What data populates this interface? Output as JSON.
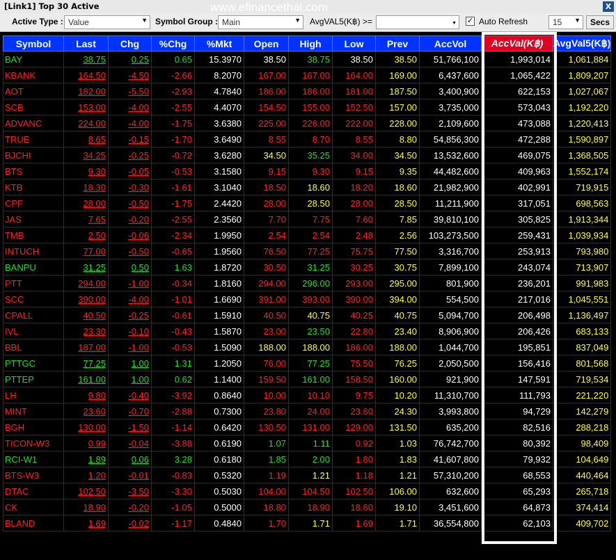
{
  "window": {
    "title": "[Link1] Top 30 Active",
    "close_label": "X",
    "watermark": "www.efinancethai.com"
  },
  "toolbar": {
    "active_type_label": "Active Type :",
    "active_type_value": "Value",
    "symbol_group_label": "Symbol Group :",
    "symbol_group_value": "Main",
    "filter_label": "AvgVAL5(K฿) >=",
    "filter_value": "",
    "auto_refresh_label": "Auto Refresh",
    "auto_refresh_checked": "✓",
    "interval_value": "15",
    "secs_label": "Secs"
  },
  "table": {
    "columns": [
      "Symbol",
      "Last",
      "Chg",
      "%Chg",
      "%Mkt",
      "Open",
      "High",
      "Low",
      "Prev",
      "AccVol",
      "AccVal(K฿)",
      "AvgVal5(K฿)"
    ],
    "rows": [
      {
        "sym": "BAY",
        "sc": "grn",
        "last": "38.75",
        "lc": "grn",
        "chg": "0.25",
        "cc": "grn",
        "pchg": "0.65",
        "pc": "grn",
        "mkt": "15.3970",
        "open": "38.50",
        "oc": "wht",
        "high": "38.75",
        "hc": "grn",
        "low": "38.50",
        "loc": "wht",
        "prev": "38.50",
        "accvol": "51,766,100",
        "accval": "1,993,014",
        "avgval": "1,061,884"
      },
      {
        "sym": "KBANK",
        "sc": "red",
        "last": "164.50",
        "lc": "red",
        "chg": "-4.50",
        "cc": "red",
        "pchg": "-2.66",
        "pc": "red",
        "mkt": "8.2070",
        "open": "167.00",
        "oc": "red",
        "high": "167.00",
        "hc": "red",
        "low": "164.00",
        "loc": "red",
        "prev": "169.00",
        "accvol": "6,437,600",
        "accval": "1,065,422",
        "avgval": "1,809,207"
      },
      {
        "sym": "AOT",
        "sc": "red",
        "last": "182.00",
        "lc": "red",
        "chg": "-5.50",
        "cc": "red",
        "pchg": "-2.93",
        "pc": "red",
        "mkt": "4.7840",
        "open": "186.00",
        "oc": "red",
        "high": "186.00",
        "hc": "red",
        "low": "181.00",
        "loc": "red",
        "prev": "187.50",
        "accvol": "3,400,900",
        "accval": "622,153",
        "avgval": "1,027,067"
      },
      {
        "sym": "SCB",
        "sc": "red",
        "last": "153.00",
        "lc": "red",
        "chg": "-4.00",
        "cc": "red",
        "pchg": "-2.55",
        "pc": "red",
        "mkt": "4.4070",
        "open": "154.50",
        "oc": "red",
        "high": "155.00",
        "hc": "red",
        "low": "152.50",
        "loc": "red",
        "prev": "157.00",
        "accvol": "3,735,000",
        "accval": "573,043",
        "avgval": "1,192,220"
      },
      {
        "sym": "ADVANC",
        "sc": "red",
        "last": "224.00",
        "lc": "red",
        "chg": "-4.00",
        "cc": "red",
        "pchg": "-1.75",
        "pc": "red",
        "mkt": "3.6380",
        "open": "225.00",
        "oc": "red",
        "high": "226.00",
        "hc": "red",
        "low": "222.00",
        "loc": "red",
        "prev": "228.00",
        "accvol": "2,109,600",
        "accval": "473,088",
        "avgval": "1,220,413"
      },
      {
        "sym": "TRUE",
        "sc": "red",
        "last": "8.65",
        "lc": "red",
        "chg": "-0.15",
        "cc": "red",
        "pchg": "-1.70",
        "pc": "red",
        "mkt": "3.6490",
        "open": "8.55",
        "oc": "red",
        "high": "8.70",
        "hc": "red",
        "low": "8.55",
        "loc": "red",
        "prev": "8.80",
        "accvol": "54,856,300",
        "accval": "472,288",
        "avgval": "1,590,897"
      },
      {
        "sym": "BJCHI",
        "sc": "red",
        "last": "34.25",
        "lc": "red",
        "chg": "-0.25",
        "cc": "red",
        "pchg": "-0.72",
        "pc": "red",
        "mkt": "3.6280",
        "open": "34.50",
        "oc": "yel",
        "high": "35.25",
        "hc": "grn",
        "low": "34.00",
        "loc": "red",
        "prev": "34.50",
        "accvol": "13,532,600",
        "accval": "469,075",
        "avgval": "1,368,505"
      },
      {
        "sym": "BTS",
        "sc": "red",
        "last": "9.30",
        "lc": "red",
        "chg": "-0.05",
        "cc": "red",
        "pchg": "-0.53",
        "pc": "red",
        "mkt": "3.1580",
        "open": "9.15",
        "oc": "red",
        "high": "9.30",
        "hc": "red",
        "low": "9.15",
        "loc": "red",
        "prev": "9.35",
        "accvol": "44,482,600",
        "accval": "409,963",
        "avgval": "1,552,174"
      },
      {
        "sym": "KTB",
        "sc": "red",
        "last": "18.30",
        "lc": "red",
        "chg": "-0.30",
        "cc": "red",
        "pchg": "-1.61",
        "pc": "red",
        "mkt": "3.1040",
        "open": "18.50",
        "oc": "red",
        "high": "18.60",
        "hc": "yel",
        "low": "18.20",
        "loc": "red",
        "prev": "18.60",
        "accvol": "21,982,900",
        "accval": "402,991",
        "avgval": "719,915"
      },
      {
        "sym": "CPF",
        "sc": "red",
        "last": "28.00",
        "lc": "red",
        "chg": "-0.50",
        "cc": "red",
        "pchg": "-1.75",
        "pc": "red",
        "mkt": "2.4420",
        "open": "28.00",
        "oc": "red",
        "high": "28.50",
        "hc": "yel",
        "low": "28.00",
        "loc": "red",
        "prev": "28.50",
        "accvol": "11,211,900",
        "accval": "317,051",
        "avgval": "698,563"
      },
      {
        "sym": "JAS",
        "sc": "red",
        "last": "7.65",
        "lc": "red",
        "chg": "-0.20",
        "cc": "red",
        "pchg": "-2.55",
        "pc": "red",
        "mkt": "2.3560",
        "open": "7.70",
        "oc": "red",
        "high": "7.75",
        "hc": "red",
        "low": "7.60",
        "loc": "red",
        "prev": "7.85",
        "accvol": "39,810,100",
        "accval": "305,825",
        "avgval": "1,913,344"
      },
      {
        "sym": "TMB",
        "sc": "red",
        "last": "2.50",
        "lc": "red",
        "chg": "-0.06",
        "cc": "red",
        "pchg": "-2.34",
        "pc": "red",
        "mkt": "1.9950",
        "open": "2.54",
        "oc": "red",
        "high": "2.54",
        "hc": "red",
        "low": "2.48",
        "loc": "red",
        "prev": "2.56",
        "accvol": "103,273,500",
        "accval": "259,431",
        "avgval": "1,039,934"
      },
      {
        "sym": "INTUCH",
        "sc": "red",
        "last": "77.00",
        "lc": "red",
        "chg": "-0.50",
        "cc": "red",
        "pchg": "-0.65",
        "pc": "red",
        "mkt": "1.9560",
        "open": "76.50",
        "oc": "red",
        "high": "77.25",
        "hc": "red",
        "low": "75.75",
        "loc": "red",
        "prev": "77.50",
        "accvol": "3,316,700",
        "accval": "253,913",
        "avgval": "793,980"
      },
      {
        "sym": "BANPU",
        "sc": "grn",
        "last": "31.25",
        "lc": "grn",
        "chg": "0.50",
        "cc": "grn",
        "pchg": "1.63",
        "pc": "grn",
        "mkt": "1.8720",
        "open": "30.50",
        "oc": "red",
        "high": "31.25",
        "hc": "grn",
        "low": "30.25",
        "loc": "red",
        "prev": "30.75",
        "accvol": "7,899,100",
        "accval": "243,074",
        "avgval": "713,907"
      },
      {
        "sym": "PTT",
        "sc": "red",
        "last": "294.00",
        "lc": "red",
        "chg": "-1.00",
        "cc": "red",
        "pchg": "-0.34",
        "pc": "red",
        "mkt": "1.8160",
        "open": "294.00",
        "oc": "red",
        "high": "296.00",
        "hc": "grn",
        "low": "293.00",
        "loc": "red",
        "prev": "295.00",
        "accvol": "801,900",
        "accval": "236,201",
        "avgval": "991,983"
      },
      {
        "sym": "SCC",
        "sc": "red",
        "last": "390.00",
        "lc": "red",
        "chg": "-4.00",
        "cc": "red",
        "pchg": "-1.01",
        "pc": "red",
        "mkt": "1.6690",
        "open": "391.00",
        "oc": "red",
        "high": "393.00",
        "hc": "red",
        "low": "390.00",
        "loc": "red",
        "prev": "394.00",
        "accvol": "554,500",
        "accval": "217,016",
        "avgval": "1,045,551"
      },
      {
        "sym": "CPALL",
        "sc": "red",
        "last": "40.50",
        "lc": "red",
        "chg": "-0.25",
        "cc": "red",
        "pchg": "-0.61",
        "pc": "red",
        "mkt": "1.5910",
        "open": "40.50",
        "oc": "red",
        "high": "40.75",
        "hc": "yel",
        "low": "40.25",
        "loc": "red",
        "prev": "40.75",
        "accvol": "5,094,700",
        "accval": "206,498",
        "avgval": "1,136,497"
      },
      {
        "sym": "IVL",
        "sc": "red",
        "last": "23.30",
        "lc": "red",
        "chg": "-0.10",
        "cc": "red",
        "pchg": "-0.43",
        "pc": "red",
        "mkt": "1.5870",
        "open": "23.00",
        "oc": "red",
        "high": "23.50",
        "hc": "grn",
        "low": "22.80",
        "loc": "red",
        "prev": "23.40",
        "accvol": "8,906,900",
        "accval": "206,426",
        "avgval": "683,133"
      },
      {
        "sym": "BBL",
        "sc": "red",
        "last": "187.00",
        "lc": "red",
        "chg": "-1.00",
        "cc": "red",
        "pchg": "-0.53",
        "pc": "red",
        "mkt": "1.5090",
        "open": "188.00",
        "oc": "yel",
        "high": "188.00",
        "hc": "yel",
        "low": "186.00",
        "loc": "red",
        "prev": "188.00",
        "accvol": "1,044,700",
        "accval": "195,851",
        "avgval": "837,049"
      },
      {
        "sym": "PTTGC",
        "sc": "grn",
        "last": "77.25",
        "lc": "grn",
        "chg": "1.00",
        "cc": "grn",
        "pchg": "1.31",
        "pc": "grn",
        "mkt": "1.2050",
        "open": "76.00",
        "oc": "red",
        "high": "77.25",
        "hc": "grn",
        "low": "75.50",
        "loc": "red",
        "prev": "76.25",
        "accvol": "2,050,500",
        "accval": "156,416",
        "avgval": "801,568"
      },
      {
        "sym": "PTTEP",
        "sc": "grn",
        "last": "161.00",
        "lc": "grn",
        "chg": "1.00",
        "cc": "grn",
        "pchg": "0.62",
        "pc": "grn",
        "mkt": "1.1400",
        "open": "159.50",
        "oc": "red",
        "high": "161.00",
        "hc": "grn",
        "low": "158.50",
        "loc": "red",
        "prev": "160.00",
        "accvol": "921,900",
        "accval": "147,591",
        "avgval": "719,534"
      },
      {
        "sym": "LH",
        "sc": "red",
        "last": "9.80",
        "lc": "red",
        "chg": "-0.40",
        "cc": "red",
        "pchg": "-3.92",
        "pc": "red",
        "mkt": "0.8640",
        "open": "10.00",
        "oc": "red",
        "high": "10.10",
        "hc": "red",
        "low": "9.75",
        "loc": "red",
        "prev": "10.20",
        "accvol": "11,310,700",
        "accval": "111,793",
        "avgval": "221,220"
      },
      {
        "sym": "MINT",
        "sc": "red",
        "last": "23.60",
        "lc": "red",
        "chg": "-0.70",
        "cc": "red",
        "pchg": "-2.88",
        "pc": "red",
        "mkt": "0.7300",
        "open": "23.80",
        "oc": "red",
        "high": "24.00",
        "hc": "red",
        "low": "23.60",
        "loc": "red",
        "prev": "24.30",
        "accvol": "3,993,800",
        "accval": "94,729",
        "avgval": "142,279"
      },
      {
        "sym": "BGH",
        "sc": "red",
        "last": "130.00",
        "lc": "red",
        "chg": "-1.50",
        "cc": "red",
        "pchg": "-1.14",
        "pc": "red",
        "mkt": "0.6420",
        "open": "130.50",
        "oc": "red",
        "high": "131.00",
        "hc": "red",
        "low": "129.00",
        "loc": "red",
        "prev": "131.50",
        "accvol": "635,200",
        "accval": "82,516",
        "avgval": "288,218"
      },
      {
        "sym": "TICON-W3",
        "sc": "red",
        "last": "0.99",
        "lc": "red",
        "chg": "-0.04",
        "cc": "red",
        "pchg": "-3.88",
        "pc": "red",
        "mkt": "0.6190",
        "open": "1.07",
        "oc": "grn",
        "high": "1.11",
        "hc": "grn",
        "low": "0.92",
        "loc": "red",
        "prev": "1.03",
        "accvol": "76,742,700",
        "accval": "80,392",
        "avgval": "98,409"
      },
      {
        "sym": "RCI-W1",
        "sc": "grn",
        "last": "1.89",
        "lc": "grn",
        "chg": "0.06",
        "cc": "grn",
        "pchg": "3.28",
        "pc": "grn",
        "mkt": "0.6180",
        "open": "1.85",
        "oc": "grn",
        "high": "2.00",
        "hc": "grn",
        "low": "1.80",
        "loc": "red",
        "prev": "1.83",
        "accvol": "41,607,800",
        "accval": "79,932",
        "avgval": "104,649"
      },
      {
        "sym": "BTS-W3",
        "sc": "red",
        "last": "1.20",
        "lc": "red",
        "chg": "-0.01",
        "cc": "red",
        "pchg": "-0.83",
        "pc": "red",
        "mkt": "0.5320",
        "open": "1.19",
        "oc": "red",
        "high": "1.21",
        "hc": "yel",
        "low": "1.18",
        "loc": "red",
        "prev": "1.21",
        "accvol": "57,310,200",
        "accval": "68,553",
        "avgval": "440,464"
      },
      {
        "sym": "DTAC",
        "sc": "red",
        "last": "102.50",
        "lc": "red",
        "chg": "-3.50",
        "cc": "red",
        "pchg": "-3.30",
        "pc": "red",
        "mkt": "0.5030",
        "open": "104.00",
        "oc": "red",
        "high": "104.50",
        "hc": "red",
        "low": "102.50",
        "loc": "red",
        "prev": "106.00",
        "accvol": "632,600",
        "accval": "65,293",
        "avgval": "265,718"
      },
      {
        "sym": "CK",
        "sc": "red",
        "last": "18.90",
        "lc": "red",
        "chg": "-0.20",
        "cc": "red",
        "pchg": "-1.05",
        "pc": "red",
        "mkt": "0.5000",
        "open": "18.80",
        "oc": "red",
        "high": "18.90",
        "hc": "red",
        "low": "18.60",
        "loc": "red",
        "prev": "19.10",
        "accvol": "3,451,600",
        "accval": "64,873",
        "avgval": "374,414"
      },
      {
        "sym": "BLAND",
        "sc": "red",
        "last": "1.69",
        "lc": "red",
        "chg": "-0.02",
        "cc": "red",
        "pchg": "-1.17",
        "pc": "red",
        "mkt": "0.4840",
        "open": "1.70",
        "oc": "red",
        "high": "1.71",
        "hc": "yel",
        "low": "1.69",
        "loc": "red",
        "prev": "1.71",
        "accvol": "36,554,800",
        "accval": "62,103",
        "avgval": "409,702"
      }
    ]
  },
  "colors": {
    "header_bg": "#0033ff",
    "highlight_header": "#e00020",
    "up": "#22dd22",
    "down": "#ff2020",
    "unchanged": "#ffff33"
  }
}
